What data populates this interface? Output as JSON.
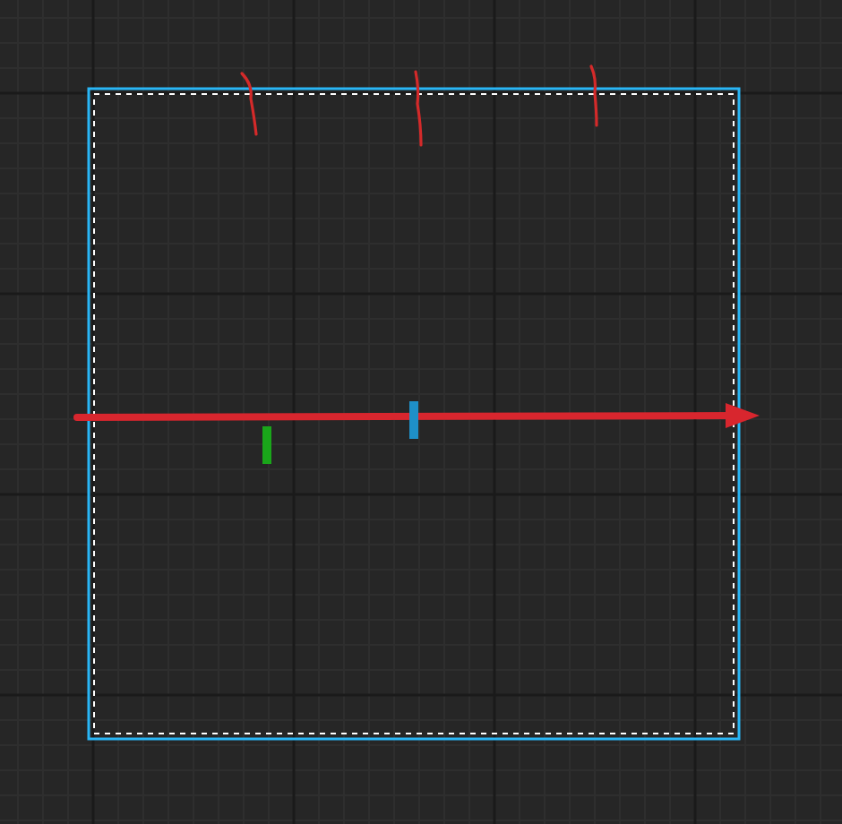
{
  "selection": {
    "visible": true
  },
  "marks": [
    {
      "kind": "tick",
      "color": "#1aa61a"
    },
    {
      "kind": "tick",
      "color": "#1e90c8"
    }
  ],
  "strokes": [
    {
      "kind": "squiggle"
    },
    {
      "kind": "squiggle"
    },
    {
      "kind": "squiggle"
    }
  ]
}
